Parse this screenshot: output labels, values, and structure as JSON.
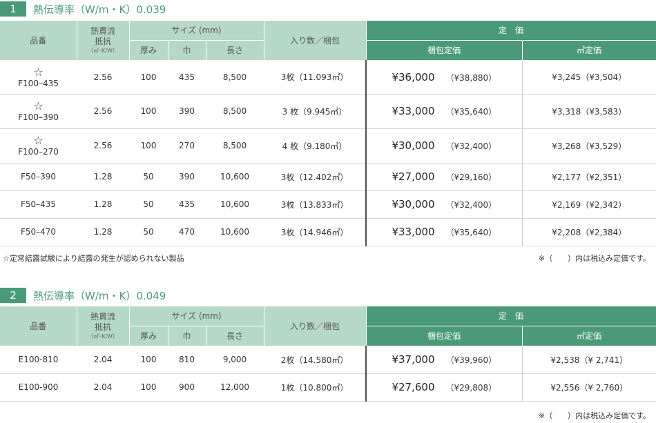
{
  "sections": [
    {
      "number": "1",
      "title": "熱伝導率（W/m・K）0.039",
      "rows": [
        {
          "mark": "☆",
          "code": "F100–435",
          "resistance": "2.56",
          "thickness": "100",
          "width": "435",
          "length": "8,500",
          "pack": "3枚（11.093㎡）",
          "price": "¥36,000",
          "price_tax": "（¥38,880）",
          "sqm": "¥3,245（¥3,504）"
        },
        {
          "mark": "☆",
          "code": "F100–390",
          "resistance": "2.56",
          "thickness": "100",
          "width": "390",
          "length": "8,500",
          "pack": "3 枚（9.945㎡）",
          "price": "¥33,000",
          "price_tax": "（¥35,640）",
          "sqm": "¥3,318（¥3,583）"
        },
        {
          "mark": "☆",
          "code": "F100–270",
          "resistance": "2.56",
          "thickness": "100",
          "width": "270",
          "length": "8,500",
          "pack": "4 枚（9.180㎡）",
          "price": "¥30,000",
          "price_tax": "（¥32,400）",
          "sqm": "¥3,268（¥3,529）"
        },
        {
          "mark": "",
          "code": "F50–390",
          "resistance": "1.28",
          "thickness": "50",
          "width": "390",
          "length": "10,600",
          "pack": "3枚（12.402㎡）",
          "price": "¥27,000",
          "price_tax": "（¥29,160）",
          "sqm": "¥2,177（¥2,351）"
        },
        {
          "mark": "",
          "code": "F50–435",
          "resistance": "1.28",
          "thickness": "50",
          "width": "435",
          "length": "10,600",
          "pack": "3枚（13.833㎡）",
          "price": "¥30,000",
          "price_tax": "（¥32,400）",
          "sqm": "¥2,169（¥2,342）"
        },
        {
          "mark": "",
          "code": "F50–470",
          "resistance": "1.28",
          "thickness": "50",
          "width": "470",
          "length": "10,600",
          "pack": "3枚（14.946㎡）",
          "price": "¥33,000",
          "price_tax": "（¥35,640）",
          "sqm": "¥2,208（¥2,384）"
        }
      ],
      "note_left": "☆定常結露試験により結露の発生が認められない製品",
      "note_right": "※（　　）内は税込み定価です。"
    },
    {
      "number": "2",
      "title": "熱伝導率（W/m・K）0.049",
      "rows": [
        {
          "mark": "",
          "code": "E100-810",
          "resistance": "2.04",
          "thickness": "100",
          "width": "810",
          "length": "9,000",
          "pack": "2枚（14.580㎡）",
          "price": "¥37,000",
          "price_tax": "（¥39,960）",
          "sqm": "¥2,538（¥ 2,741）"
        },
        {
          "mark": "",
          "code": "E100-900",
          "resistance": "2.04",
          "thickness": "100",
          "width": "900",
          "length": "12,000",
          "pack": "1枚（10.800㎡）",
          "price": "¥27,600",
          "price_tax": "（¥29,808）",
          "sqm": "¥2,556（¥ 2,760）"
        }
      ],
      "note_left": "",
      "note_right": "※（　　）内は税込み定価です。"
    }
  ],
  "headers": {
    "code": "品番",
    "resistance_line1": "熱貫流",
    "resistance_line2": "抵抗",
    "resistance_unit": "（㎡･K/W）",
    "size": "サイズ (mm)",
    "thickness": "厚み",
    "width": "巾",
    "length": "長さ",
    "pack": "入り数／梱包",
    "list_price": "定　価",
    "pack_price": "梱包定価",
    "sqm_price": "㎡定価"
  },
  "colors": {
    "accent": "#4a9a7a",
    "header_light": "#b6d8c8"
  }
}
